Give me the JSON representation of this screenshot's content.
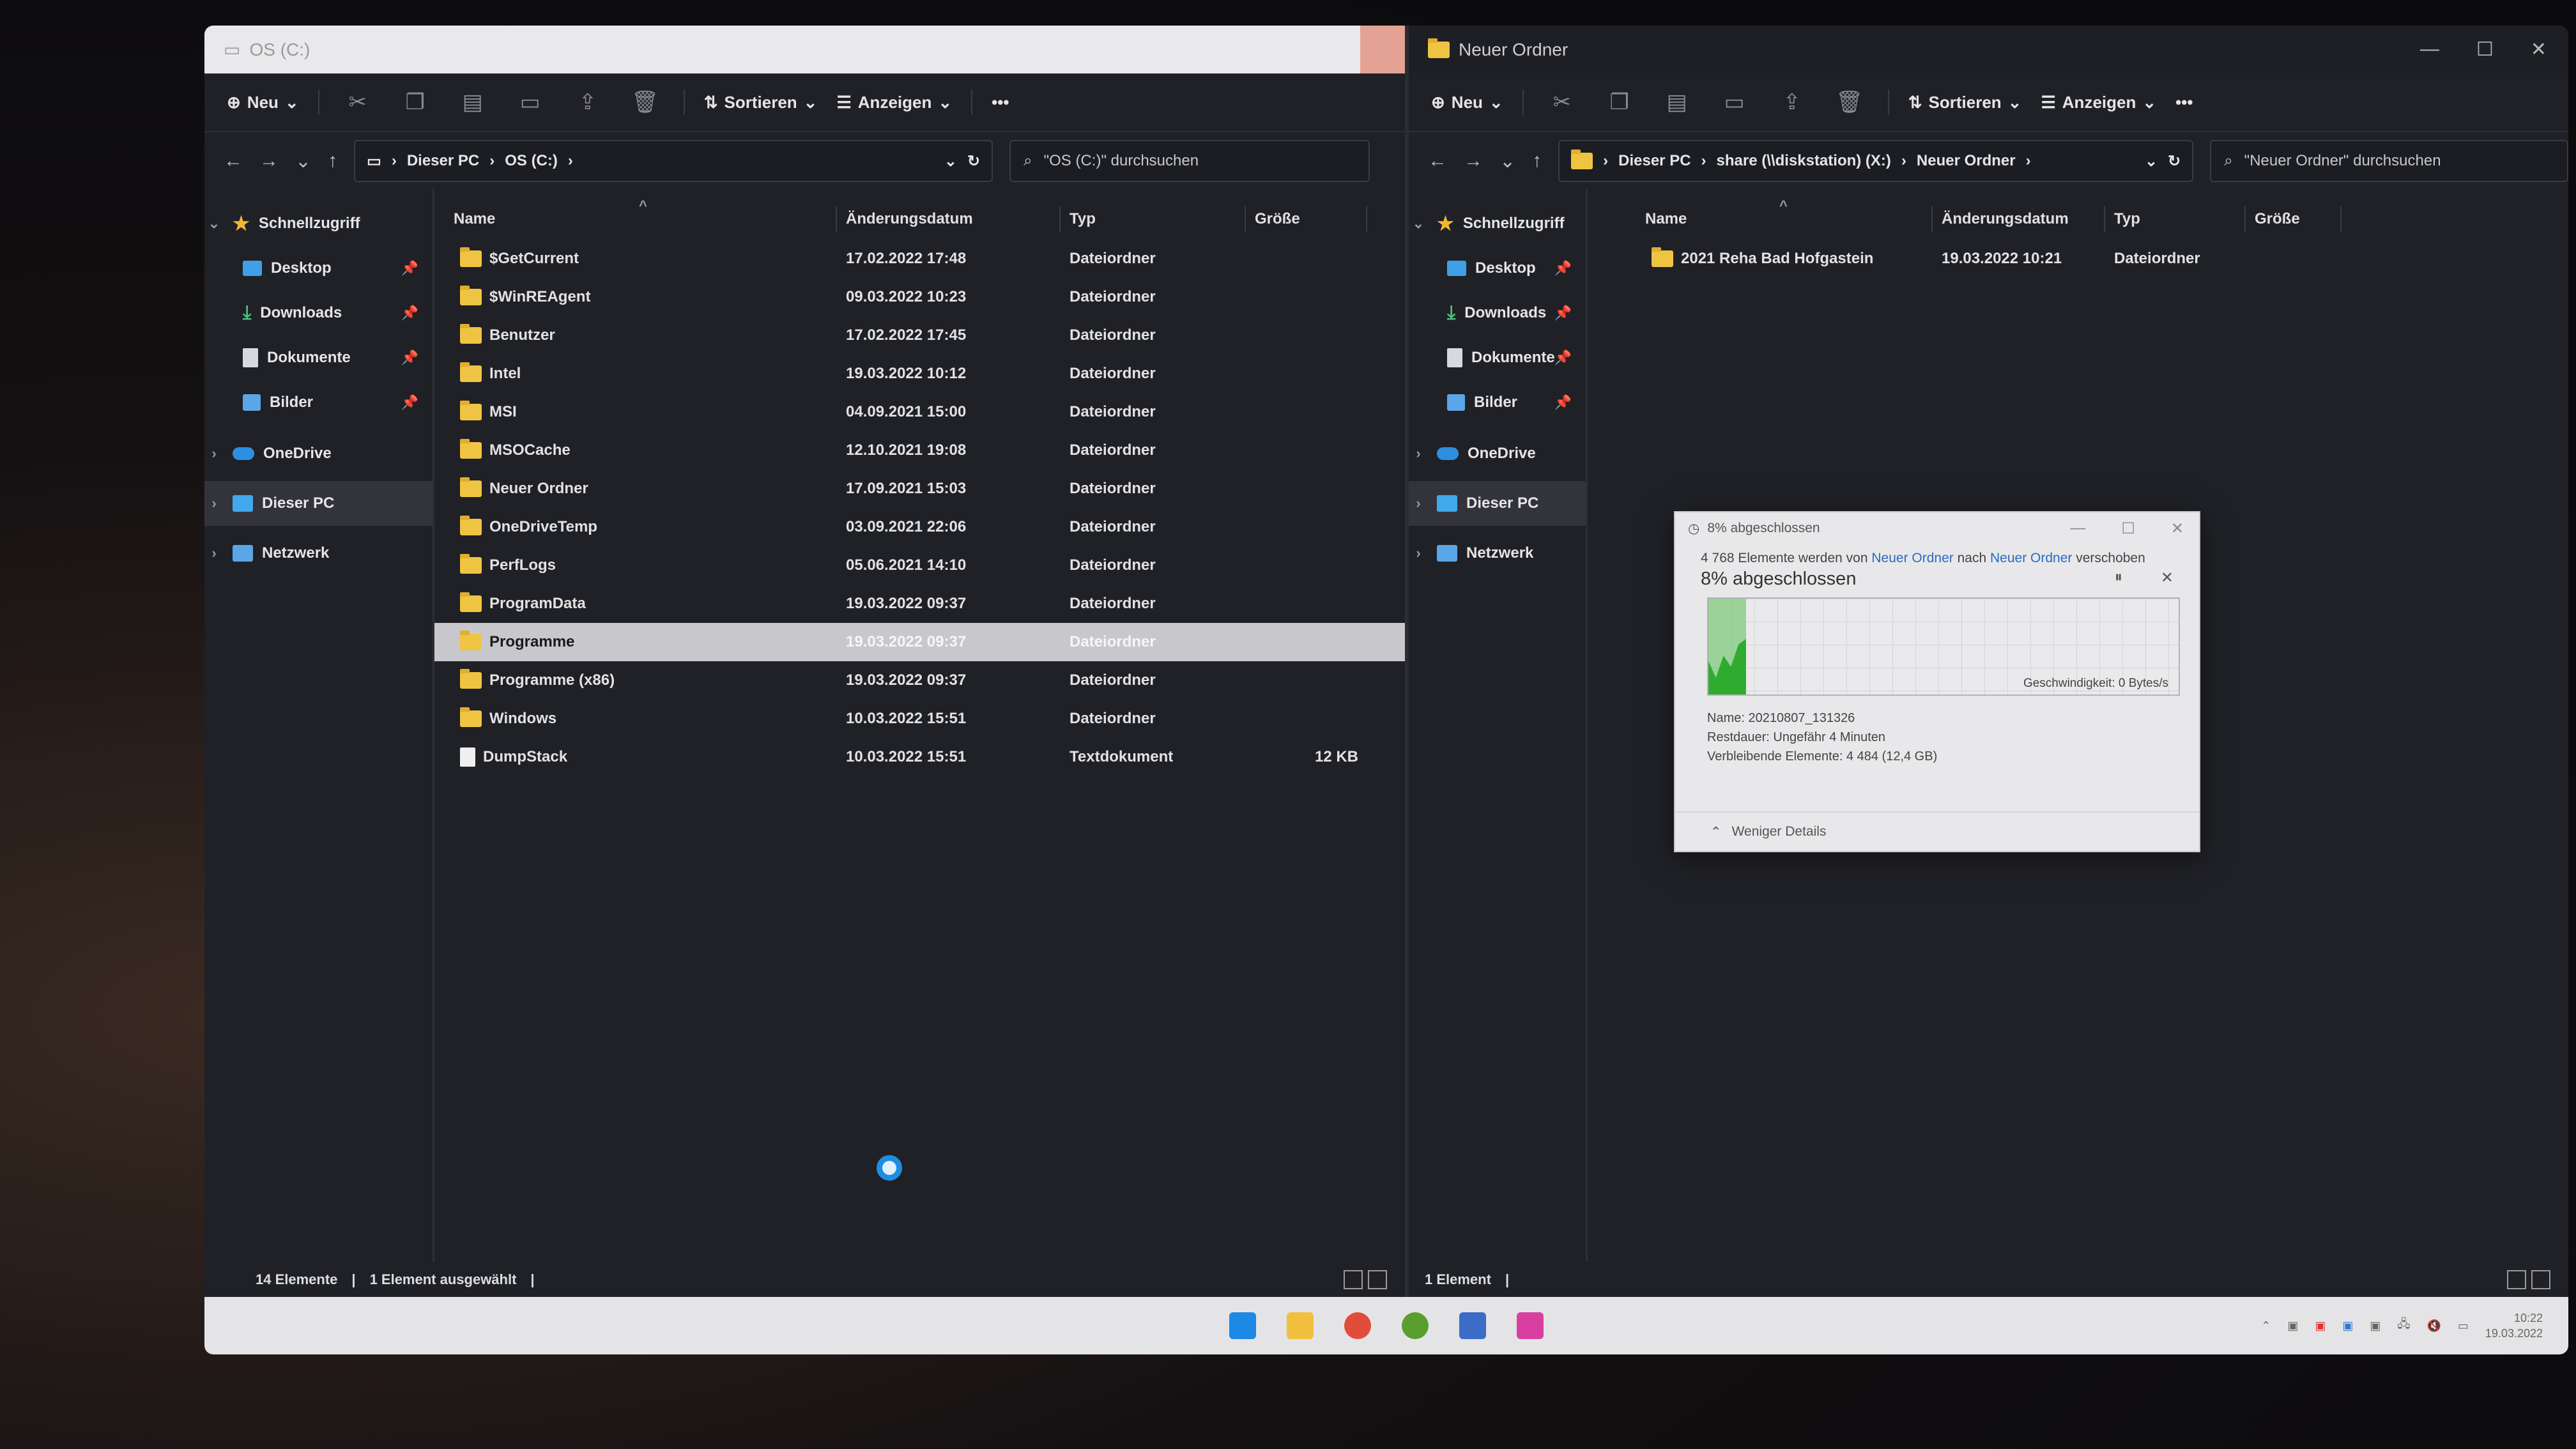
{
  "left_window": {
    "title": "OS (C:)",
    "toolbar": {
      "new": "Neu",
      "sort": "Sortieren",
      "view": "Anzeigen",
      "more": "•••"
    },
    "breadcrumb": [
      "Dieser PC",
      "OS (C:)"
    ],
    "search_placeholder": "\"OS (C:)\" durchsuchen",
    "sidebar": {
      "quick": "Schnellzugriff",
      "items": [
        "Desktop",
        "Downloads",
        "Dokumente",
        "Bilder"
      ],
      "onedrive": "OneDrive",
      "thispc": "Dieser PC",
      "network": "Netzwerk"
    },
    "columns": {
      "name": "Name",
      "date": "Änderungsdatum",
      "type": "Typ",
      "size": "Größe"
    },
    "rows": [
      {
        "name": "$GetCurrent",
        "date": "17.02.2022 17:48",
        "type": "Dateiordner",
        "size": ""
      },
      {
        "name": "$WinREAgent",
        "date": "09.03.2022 10:23",
        "type": "Dateiordner",
        "size": ""
      },
      {
        "name": "Benutzer",
        "date": "17.02.2022 17:45",
        "type": "Dateiordner",
        "size": ""
      },
      {
        "name": "Intel",
        "date": "19.03.2022 10:12",
        "type": "Dateiordner",
        "size": ""
      },
      {
        "name": "MSI",
        "date": "04.09.2021 15:00",
        "type": "Dateiordner",
        "size": ""
      },
      {
        "name": "MSOCache",
        "date": "12.10.2021 19:08",
        "type": "Dateiordner",
        "size": ""
      },
      {
        "name": "Neuer Ordner",
        "date": "17.09.2021 15:03",
        "type": "Dateiordner",
        "size": ""
      },
      {
        "name": "OneDriveTemp",
        "date": "03.09.2021 22:06",
        "type": "Dateiordner",
        "size": ""
      },
      {
        "name": "PerfLogs",
        "date": "05.06.2021 14:10",
        "type": "Dateiordner",
        "size": ""
      },
      {
        "name": "ProgramData",
        "date": "19.03.2022 09:37",
        "type": "Dateiordner",
        "size": ""
      },
      {
        "name": "Programme",
        "date": "19.03.2022 09:37",
        "type": "Dateiordner",
        "size": ""
      },
      {
        "name": "Programme (x86)",
        "date": "19.03.2022 09:37",
        "type": "Dateiordner",
        "size": ""
      },
      {
        "name": "Windows",
        "date": "10.03.2022 15:51",
        "type": "Dateiordner",
        "size": ""
      },
      {
        "name": "DumpStack",
        "date": "10.03.2022 15:51",
        "type": "Textdokument",
        "size": "12 KB"
      }
    ],
    "status": {
      "count": "14 Elemente",
      "selected": "1 Element ausgewählt"
    }
  },
  "right_window": {
    "title": "Neuer Ordner",
    "toolbar": {
      "new": "Neu",
      "sort": "Sortieren",
      "view": "Anzeigen",
      "more": "•••"
    },
    "breadcrumb": [
      "Dieser PC",
      "share (\\\\diskstation) (X:)",
      "Neuer Ordner"
    ],
    "search_placeholder": "\"Neuer Ordner\" durchsuchen",
    "sidebar": {
      "quick": "Schnellzugriff",
      "items": [
        "Desktop",
        "Downloads",
        "Dokumente",
        "Bilder"
      ],
      "onedrive": "OneDrive",
      "thispc": "Dieser PC",
      "network": "Netzwerk"
    },
    "columns": {
      "name": "Name",
      "date": "Änderungsdatum",
      "type": "Typ",
      "size": "Größe"
    },
    "rows": [
      {
        "name": "2021 Reha Bad Hofgastein",
        "date": "19.03.2022 10:21",
        "type": "Dateiordner",
        "size": ""
      }
    ],
    "status": {
      "count": "1 Element"
    }
  },
  "progress_dialog": {
    "title": "8% abgeschlossen",
    "line_prefix": "4 768 Elemente werden von",
    "from": "Neuer Ordner",
    "mid": "nach",
    "to": "Neuer Ordner",
    "line_suffix": "verschoben",
    "percent_label": "8% abgeschlossen",
    "progress": 0.08,
    "speed": "Geschwindigkeit: 0 Bytes/s",
    "name": "Name: 20210807_131326",
    "remaining_time": "Restdauer: Ungefähr 4 Minuten",
    "remaining_items": "Verbleibende Elemente: 4 484 (12,4 GB)",
    "less_details": "Weniger Details"
  },
  "taskbar": {
    "time": "10:22",
    "date": "19.03.2022"
  }
}
